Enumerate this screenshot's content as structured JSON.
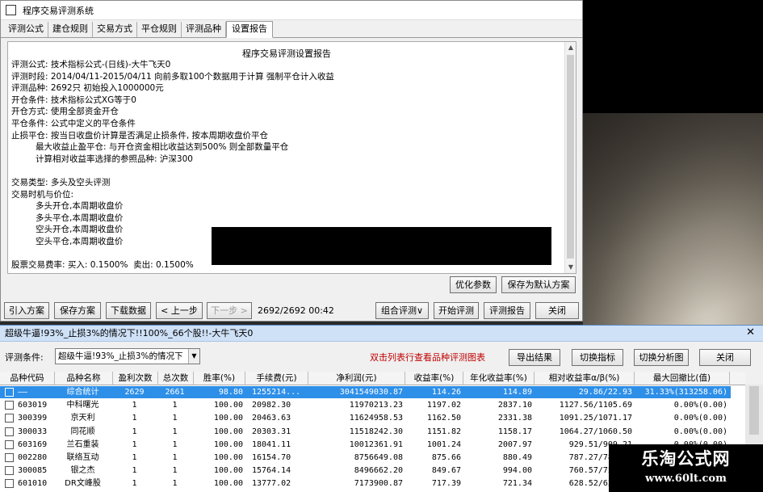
{
  "window1": {
    "title": "程序交易评测系统",
    "tabs": [
      "评测公式",
      "建仓规则",
      "交易方式",
      "平仓规则",
      "评测品种",
      "设置报告"
    ],
    "active_tab": 5,
    "report": {
      "title": "程序交易评测设置报告",
      "lines": [
        "评测公式: 技术指标公式-(日线)-大牛飞天0",
        "评测时段: 2014/04/11-2015/04/11 向前多取100个数据用于计算 强制平仓计入收益",
        "评测品种: 2692只 初始投入1000000元",
        "开仓条件: 技术指标公式XG等于0",
        "开仓方式: 使用全部资金开仓",
        "平仓条件: 公式中定义的平仓条件",
        "止损平仓: 按当日收盘价计算是否满足止损条件, 按本周期收盘价平仓",
        "         最大收益止盈平仓: 与开仓资金相比收益达到500% 则全部数量平仓",
        "         计算相对收益率选择的参照品种: 沪深300",
        "",
        "交易类型: 多头及空头评测",
        "交易时机与价位:",
        "         多头开仓,本周期收盘价",
        "         多头平仓,本周期收盘价",
        "         空头开仓,本周期收盘价",
        "         空头平仓,本周期收盘价",
        "",
        "股票交易费率: 买入: 0.1500%  卖出: 0.1500%"
      ]
    },
    "buttons": {
      "optimize": "优化参数",
      "save_default": "保存为默认方案",
      "import": "引入方案",
      "save_plan": "保存方案",
      "download": "下载数据",
      "prev": "< 上一步",
      "next": "下一步 >",
      "combo": "组合评测∨",
      "start": "开始评测",
      "report": "评测报告",
      "close": "关闭"
    },
    "progress_text": "2692/2692 00:42"
  },
  "window2": {
    "title": "超级牛逼!93%_止损3%的情况下!!100%_66个股!!-大牛飞天0",
    "cond_label": "评测条件:",
    "cond_value": "超级牛逼!93%_止损3%的情况下",
    "hint": "双击列表行查看品种评测图表",
    "buttons": {
      "export": "导出结果",
      "switch_indicator": "切换指标",
      "switch_chart": "切换分析图",
      "close": "关闭"
    },
    "columns": [
      "品种代码",
      "品种名称",
      "盈利次数",
      "总次数",
      "胜率(%)",
      "手续费(元)",
      "净利润(元)",
      "收益率(%)",
      "年化收益率(%)",
      "相对收益率α/β(%)",
      "最大回撤比(值)"
    ],
    "rows": [
      [
        "——",
        "综合统计",
        "2629",
        "2661",
        "98.80",
        "1255214...",
        "3041549030.87",
        "114.26",
        "114.89",
        "29.86/22.93",
        "31.33%(313258.06)"
      ],
      [
        "603019",
        "中科曙光",
        "1",
        "1",
        "100.00",
        "20982.30",
        "11970213.23",
        "1197.02",
        "2837.10",
        "1127.56/1105.69",
        "0.00%(0.00)"
      ],
      [
        "300399",
        "京天利",
        "1",
        "1",
        "100.00",
        "20463.63",
        "11624958.53",
        "1162.50",
        "2331.38",
        "1091.25/1071.17",
        "0.00%(0.00)"
      ],
      [
        "300033",
        "同花顺",
        "1",
        "1",
        "100.00",
        "20303.31",
        "11518242.30",
        "1151.82",
        "1158.17",
        "1064.27/1060.50",
        "0.00%(0.00)"
      ],
      [
        "603169",
        "兰石重装",
        "1",
        "1",
        "100.00",
        "18041.11",
        "10012361.91",
        "1001.24",
        "2007.97",
        "929.51/909.21",
        "0.00%(0.00)"
      ],
      [
        "002280",
        "联络互动",
        "1",
        "1",
        "100.00",
        "16154.70",
        "8756649.08",
        "875.66",
        "880.49",
        "787.27/784.55",
        "0.00%(0.00)"
      ],
      [
        "300085",
        "银之杰",
        "1",
        "1",
        "100.00",
        "15764.14",
        "8496662.20",
        "849.67",
        "994.00",
        "760.57/758.64",
        "0.00%(0.00)"
      ],
      [
        "601010",
        "DR文峰股",
        "1",
        "1",
        "100.00",
        "13777.02",
        "7173900.87",
        "717.39",
        "721.34",
        "628.52/626.00",
        "0.00%(0.00)"
      ]
    ]
  },
  "watermark": {
    "line1": "乐淘公式网",
    "line2": "www.60lt.com"
  }
}
